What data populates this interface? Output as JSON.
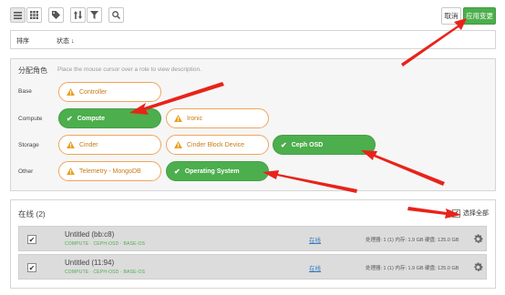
{
  "toolbar": {
    "icons": [
      "list-view-icon",
      "grid-view-icon",
      "tag-icon",
      "sort-icon",
      "filter-icon",
      "search-icon"
    ],
    "cancel_label": "取消",
    "apply_label": "应用变更"
  },
  "filter_bar": {
    "sort_label": "排序",
    "status_label": "状态"
  },
  "roles": {
    "title": "分配角色",
    "hint": "Place the mouse cursor over a role to view description.",
    "groups": [
      {
        "label": "Base",
        "items": [
          {
            "name": "Controller",
            "selected": false
          }
        ]
      },
      {
        "label": "Compute",
        "items": [
          {
            "name": "Compute",
            "selected": true
          },
          {
            "name": "Ironic",
            "selected": false
          }
        ]
      },
      {
        "label": "Storage",
        "items": [
          {
            "name": "Cinder",
            "selected": false
          },
          {
            "name": "Cinder Block Device",
            "selected": false
          },
          {
            "name": "Ceph OSD",
            "selected": true
          }
        ]
      },
      {
        "label": "Other",
        "items": [
          {
            "name": "Telemetry - MongoDB",
            "selected": false
          },
          {
            "name": "Operating System",
            "selected": true
          }
        ]
      }
    ],
    "colors": {
      "selected": "#4cae4c",
      "unselected_border": "#f0a55a",
      "warn": "#e8a020"
    }
  },
  "online": {
    "title": "在线 (2)",
    "select_all_label": "选择全部",
    "nodes": [
      {
        "name": "Untitled (bb:c8)",
        "roles": "COMPUTE · CEPH-OSD · BASE-OS",
        "status": "在线",
        "specs": "处理器: 1 (1) 内存: 1.9 GB 硬盘: 125.0 GB"
      },
      {
        "name": "Untitled (11:94)",
        "roles": "COMPUTE · CEPH-OSD · BASE-OS",
        "status": "在线",
        "specs": "处理器: 1 (1) 内存: 1.9 GB 硬盘: 125.0 GB"
      }
    ]
  }
}
